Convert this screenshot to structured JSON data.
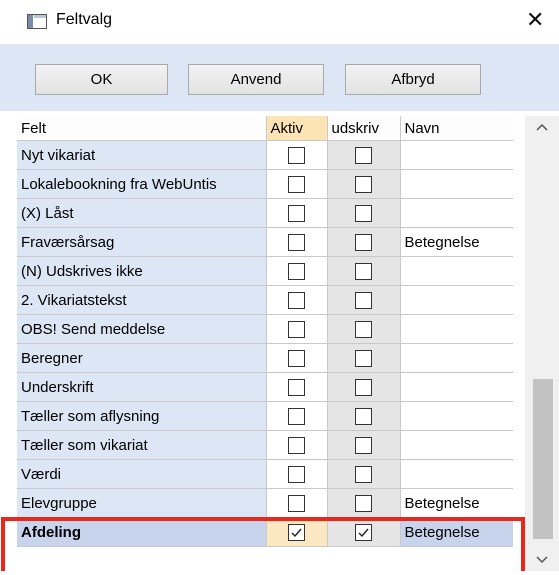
{
  "window": {
    "title": "Feltvalg",
    "close_glyph": "✕",
    "app_icon": "window-icon"
  },
  "toolbar": {
    "ok_label": "OK",
    "apply_label": "Anvend",
    "cancel_label": "Afbryd"
  },
  "grid": {
    "columns": [
      "Felt",
      "Aktiv",
      "udskriv",
      "Navn"
    ],
    "rows": [
      {
        "felt": "Nyt vikariat",
        "aktiv": false,
        "udskriv": false,
        "navn": ""
      },
      {
        "felt": "Lokalebookning fra WebUntis",
        "aktiv": false,
        "udskriv": false,
        "navn": ""
      },
      {
        "felt": "(X) Låst",
        "aktiv": false,
        "udskriv": false,
        "navn": ""
      },
      {
        "felt": "Fraværsårsag",
        "aktiv": false,
        "udskriv": false,
        "navn": "Betegnelse"
      },
      {
        "felt": "(N) Udskrives ikke",
        "aktiv": false,
        "udskriv": false,
        "navn": ""
      },
      {
        "felt": "2. Vikariatstekst",
        "aktiv": false,
        "udskriv": false,
        "navn": ""
      },
      {
        "felt": "OBS! Send meddelse",
        "aktiv": false,
        "udskriv": false,
        "navn": ""
      },
      {
        "felt": "Beregner",
        "aktiv": false,
        "udskriv": false,
        "navn": ""
      },
      {
        "felt": "Underskrift",
        "aktiv": false,
        "udskriv": false,
        "navn": ""
      },
      {
        "felt": "Tæller som aflysning",
        "aktiv": false,
        "udskriv": false,
        "navn": ""
      },
      {
        "felt": "Tæller som vikariat",
        "aktiv": false,
        "udskriv": false,
        "navn": ""
      },
      {
        "felt": "Værdi",
        "aktiv": false,
        "udskriv": false,
        "navn": ""
      },
      {
        "felt": "Elevgruppe",
        "aktiv": false,
        "udskriv": false,
        "navn": "Betegnelse"
      },
      {
        "felt": "Afdeling",
        "aktiv": true,
        "udskriv": true,
        "navn": "Betegnelse",
        "selected": true
      }
    ]
  },
  "scrollbar": {
    "up_glyph": "^",
    "down_glyph": "v"
  },
  "colors": {
    "highlight": "#e8281c",
    "toolbar_bg": "#dce6f4",
    "aktiv_header": "#fce4b6"
  }
}
